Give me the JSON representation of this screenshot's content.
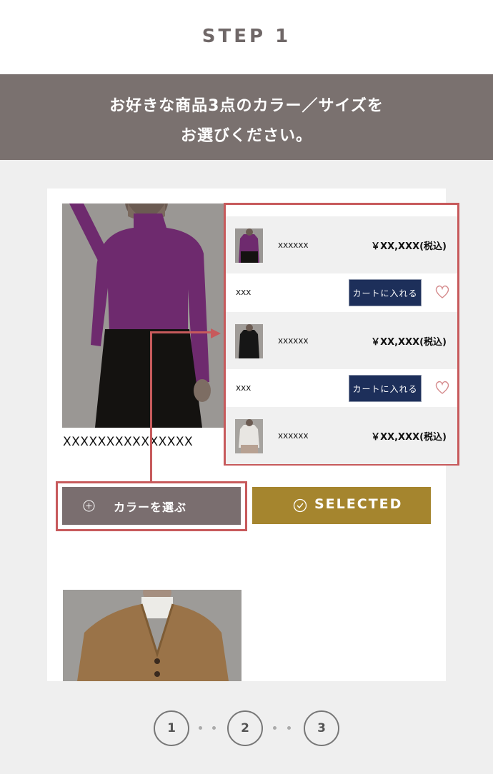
{
  "step": {
    "title": "STEP 1"
  },
  "banner": {
    "line1": "お好きな商品3点のカラー／サイズを",
    "line2": "お選びください。"
  },
  "product": {
    "name": "XXXXXXXXXXXXXXX",
    "image": "purple-turtleneck-photo"
  },
  "variants": [
    {
      "code": "xxxxxx",
      "price": "￥XX,XXX(税込)",
      "thumb": "purple-turtleneck-thumb"
    },
    {
      "code": "xxxxxx",
      "price": "￥XX,XXX(税込)",
      "thumb": "black-turtleneck-thumb"
    },
    {
      "code": "xxxxxx",
      "price": "￥XX,XXX(税込)",
      "thumb": "white-turtleneck-thumb"
    }
  ],
  "size_rows": [
    {
      "size": "xxx",
      "cart_label": "カートに入れる",
      "fav_icon": "heart-icon"
    },
    {
      "size": "xxx",
      "cart_label": "カートに入れる",
      "fav_icon": "heart-icon"
    }
  ],
  "buttons": {
    "choose_color": "カラーを選ぶ",
    "selected": "SELECTED"
  },
  "second_product": {
    "image": "camel-cardigan-photo"
  },
  "pagination": {
    "pages": [
      "1",
      "2",
      "3"
    ]
  },
  "colors": {
    "banner_bg": "#7a716f",
    "highlight": "#c75a5c",
    "cart_button": "#1d2f5a",
    "selected_button": "#a5852e",
    "color_button": "#7a6e6f"
  }
}
